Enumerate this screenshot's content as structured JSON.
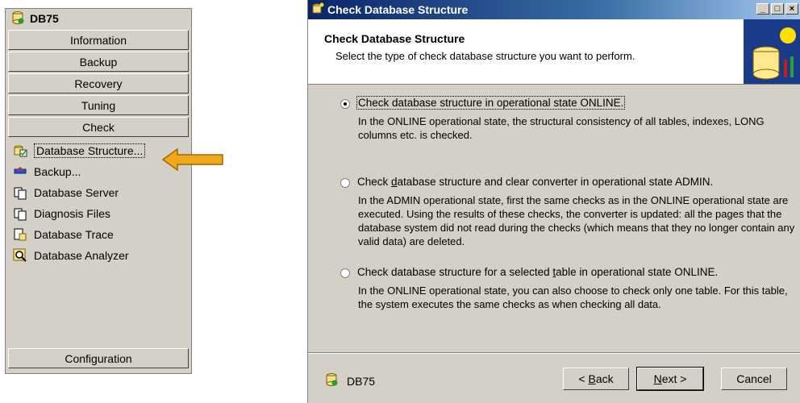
{
  "left_panel": {
    "db_name": "DB75",
    "nav_buttons": [
      "Information",
      "Backup",
      "Recovery",
      "Tuning",
      "Check"
    ],
    "sub_items": [
      {
        "label": "Database Structure...",
        "icon": "db-check-icon"
      },
      {
        "label": "Backup...",
        "icon": "backup-icon"
      },
      {
        "label": "Database Server",
        "icon": "server-icon"
      },
      {
        "label": "Diagnosis Files",
        "icon": "diagnosis-icon"
      },
      {
        "label": "Database Trace",
        "icon": "trace-icon"
      },
      {
        "label": "Database Analyzer",
        "icon": "analyzer-icon"
      }
    ],
    "config_button": "Configuration"
  },
  "dialog": {
    "title": "Check Database Structure",
    "window_buttons": [
      "_",
      "□",
      "×"
    ],
    "header_title": "Check Database Structure",
    "header_subtitle": "Select the type of check database structure you want to perform.",
    "options": [
      {
        "label": "Check database structure in operational state ONLINE.",
        "description": "In the ONLINE operational state, the structural consistency of all tables, indexes, LONG columns etc. is checked.",
        "checked": true
      },
      {
        "label": "Check database structure and clear converter in operational state ADMIN.",
        "description": "In the ADMIN operational state, first the same checks as in the ONLINE operational state are executed. Using the results of these checks, the converter is updated: all the pages that the database system did not read during the checks (which means that they no longer contain any valid data) are deleted.",
        "checked": false
      },
      {
        "label": "Check database structure for a selected table in operational state ONLINE.",
        "description": "In the ONLINE operational state, you can also choose to check only one table. For this table, the system executes the same checks as when checking all data.",
        "checked": false
      }
    ],
    "footer_db": "DB75",
    "buttons": {
      "back": "< Back",
      "next": "Next >",
      "cancel": "Cancel"
    }
  },
  "colors": {
    "titlebar_start": "#0a246a",
    "arrow": "#f0a818",
    "panel_bg": "#d4d0c8"
  }
}
